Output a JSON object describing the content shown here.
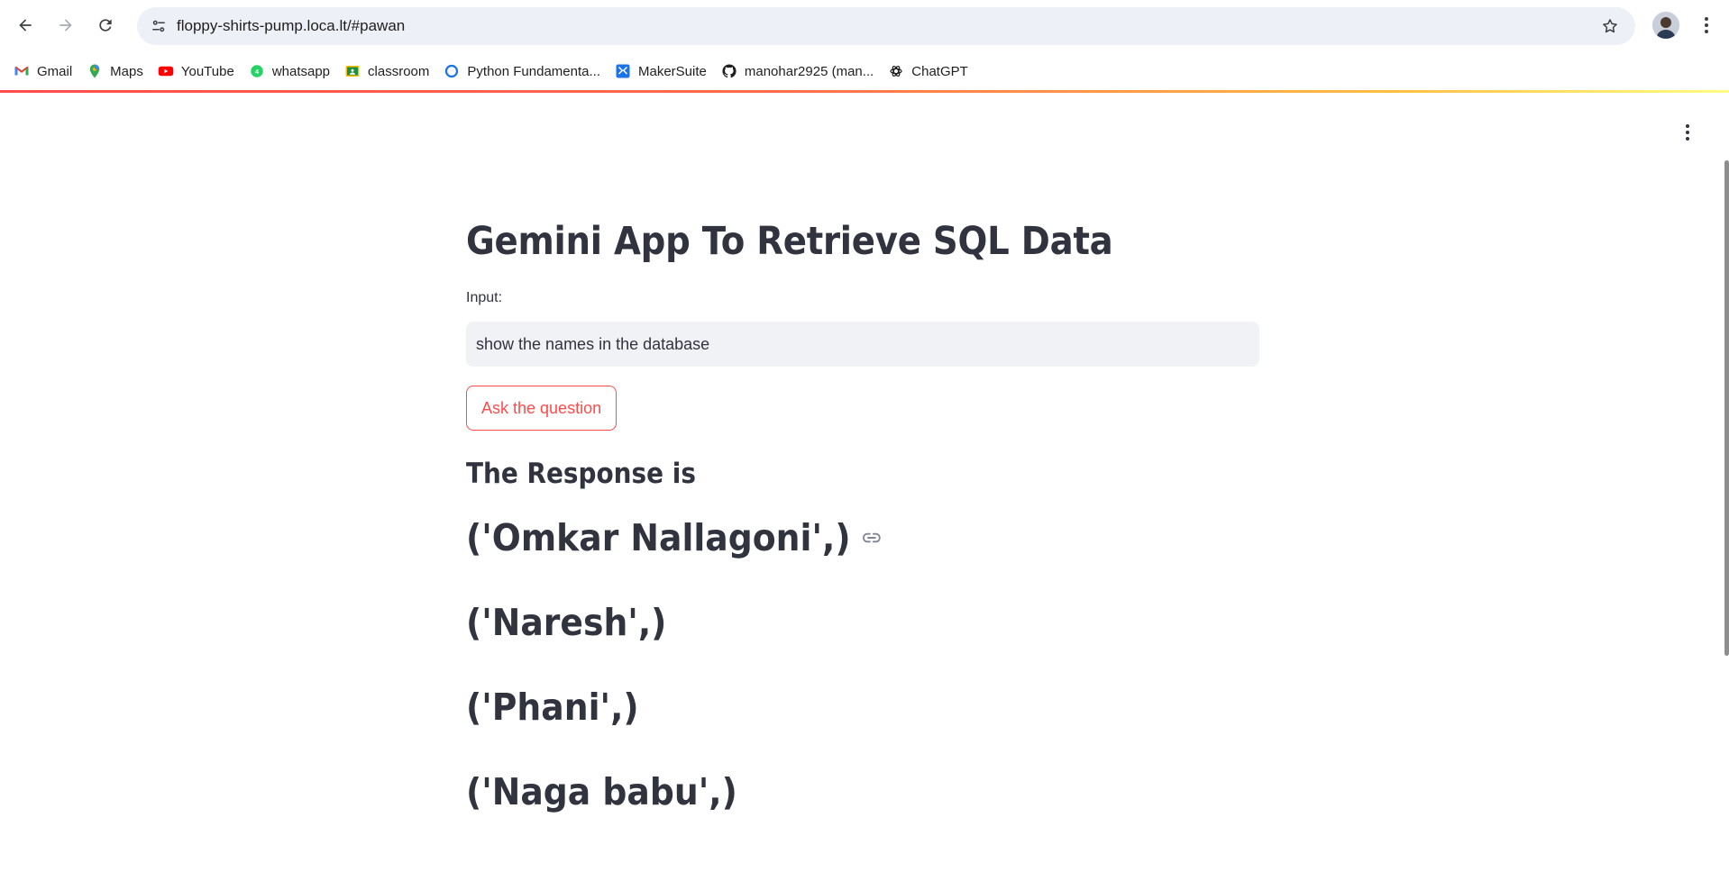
{
  "browser": {
    "url": "floppy-shirts-pump.loca.lt/#pawan",
    "bookmarks": [
      {
        "label": "Gmail",
        "icon": "gmail-icon"
      },
      {
        "label": "Maps",
        "icon": "maps-icon"
      },
      {
        "label": "YouTube",
        "icon": "youtube-icon"
      },
      {
        "label": "whatsapp",
        "icon": "whatsapp-icon"
      },
      {
        "label": "classroom",
        "icon": "classroom-icon"
      },
      {
        "label": "Python Fundamenta...",
        "icon": "python-course-icon"
      },
      {
        "label": "MakerSuite",
        "icon": "makersuite-icon"
      },
      {
        "label": "manohar2925 (man...",
        "icon": "github-icon"
      },
      {
        "label": "ChatGPT",
        "icon": "chatgpt-icon"
      }
    ]
  },
  "app": {
    "title": "Gemini App To Retrieve SQL Data",
    "input_label": "Input:",
    "input_value": "show the names in the database",
    "button_label": "Ask the question",
    "response_heading": "The Response is",
    "results": [
      "('Omkar Nallagoni',)",
      "('Naresh',)",
      "('Phani',)",
      "('Naga babu',)"
    ]
  },
  "colors": {
    "accent": "#ff4b4b",
    "text": "#31333f",
    "input_bg": "#f0f2f6"
  }
}
